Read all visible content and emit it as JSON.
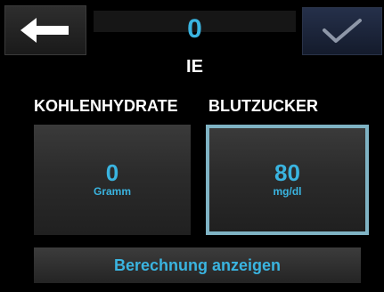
{
  "header": {
    "back_icon": "arrow-left-icon",
    "confirm_icon": "checkmark-icon",
    "units_value": "0",
    "units_label": "IE"
  },
  "carbs": {
    "heading": "KOHLENHYDRATE",
    "value": "0",
    "unit": "Gramm"
  },
  "blood_glucose": {
    "heading": "BLUTZUCKER",
    "value": "80",
    "unit": "mg/dl"
  },
  "calculation_button": {
    "label": "Berechnung anzeigen"
  },
  "colors": {
    "accent": "#3ab4e0",
    "selected_border": "#7fb3c4",
    "background": "#000000",
    "text": "#ffffff"
  }
}
